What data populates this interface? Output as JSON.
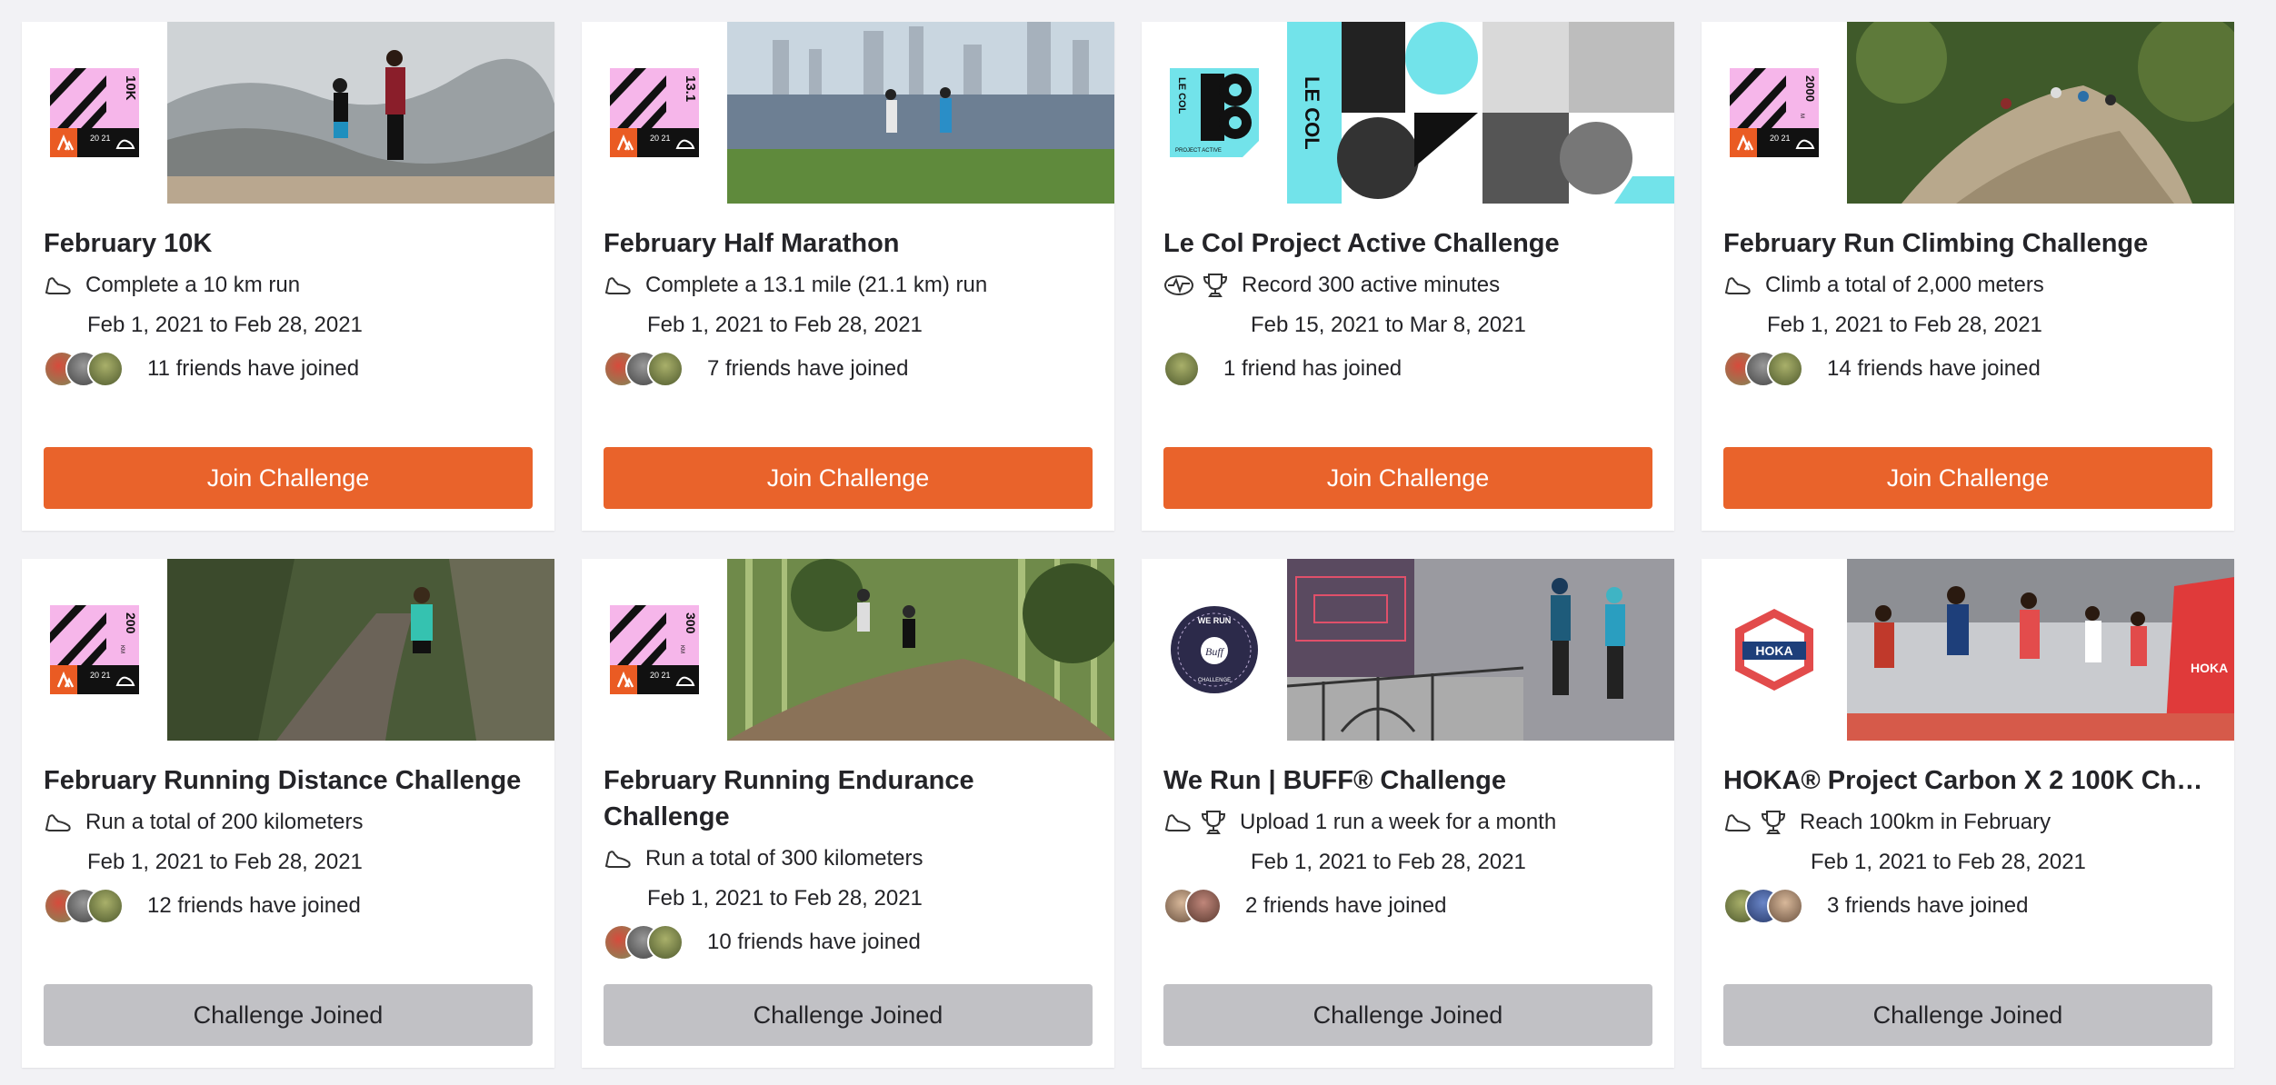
{
  "cards": [
    {
      "badge_text": "10K",
      "badge_year": "20\n21",
      "title": "February 10K",
      "goal": "Complete a 10 km run",
      "dates": "Feb 1, 2021 to Feb 28, 2021",
      "friends": "11 friends have joined",
      "button": "Join Challenge"
    },
    {
      "badge_text": "13.1",
      "badge_year": "20\n21",
      "title": "February Half Marathon",
      "goal": "Complete a 13.1 mile (21.1 km) run",
      "dates": "Feb 1, 2021 to Feb 28, 2021",
      "friends": "7 friends have joined",
      "button": "Join Challenge"
    },
    {
      "badge_text": "LE COL",
      "badge_sub": "PROJECT ACTIVE",
      "photo_text": "LE COL",
      "title": "Le Col Project Active Challenge",
      "goal": "Record 300 active minutes",
      "dates": "Feb 15, 2021 to Mar 8, 2021",
      "friends": "1 friend has joined",
      "button": "Join Challenge"
    },
    {
      "badge_text": "2000",
      "badge_unit": "M",
      "badge_year": "20\n21",
      "title": "February Run Climbing Challenge",
      "goal": "Climb a total of 2,000 meters",
      "dates": "Feb 1, 2021 to Feb 28, 2021",
      "friends": "14 friends have joined",
      "button": "Join Challenge"
    },
    {
      "badge_text": "200",
      "badge_unit": "KM",
      "badge_year": "20\n21",
      "title": "February Running Distance Challenge",
      "goal": "Run a total of 200 kilometers",
      "dates": "Feb 1, 2021 to Feb 28, 2021",
      "friends": "12 friends have joined",
      "button": "Challenge Joined"
    },
    {
      "badge_text": "300",
      "badge_unit": "KM",
      "badge_year": "20\n21",
      "title": "February Running Endurance Challenge",
      "goal": "Run a total of 300 kilometers",
      "dates": "Feb 1, 2021 to Feb 28, 2021",
      "friends": "10 friends have joined",
      "button": "Challenge Joined"
    },
    {
      "badge_text": "WE RUN",
      "badge_sub": "CHALLENGE",
      "badge_logo": "Buff",
      "title": "We Run | BUFF® Challenge",
      "goal": "Upload 1 run a week for a month",
      "dates": "Feb 1, 2021 to Feb 28, 2021",
      "friends": "2 friends have joined",
      "button": "Challenge Joined"
    },
    {
      "badge_text": "HOKA",
      "photo_text": "HOKA",
      "title": "HOKA® Project Carbon X 2 100K Cha...",
      "goal": "Reach 100km in February",
      "dates": "Feb 1, 2021 to Feb 28, 2021",
      "friends": "3 friends have joined",
      "button": "Challenge Joined"
    }
  ],
  "colors": {
    "accent": "#e9632b",
    "joined_bg": "#c1c1c5",
    "badge_pink": "#f6b6ea",
    "lecol_cyan": "#72e3ea",
    "buff_navy": "#2c2a4a"
  }
}
